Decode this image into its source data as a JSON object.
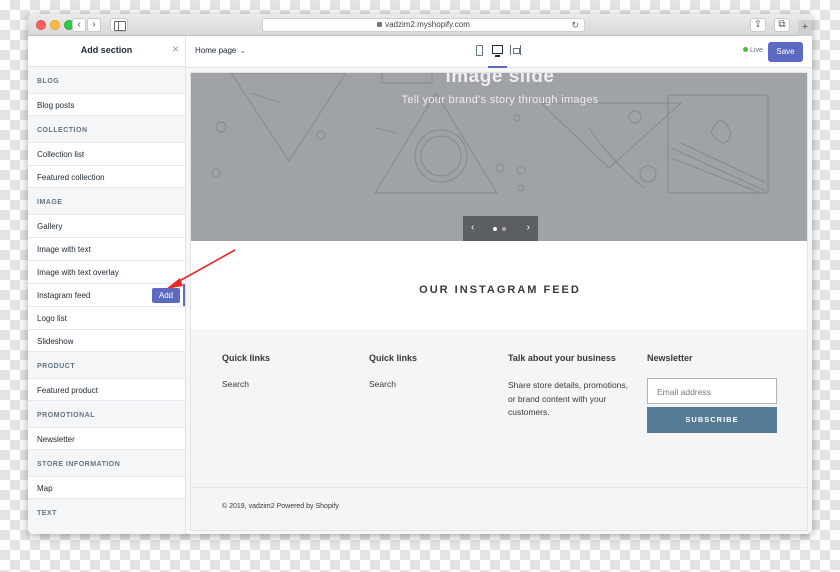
{
  "browser": {
    "url": "vadzim2.myshopify.com",
    "back": "‹",
    "forward": "›",
    "reload": "↻",
    "new_tab": "+",
    "share": "⇪",
    "tabs": "⧉"
  },
  "sidebar": {
    "title": "Add section",
    "close": "×",
    "groups": [
      {
        "label": "BLOG",
        "items": [
          {
            "label": "Blog posts"
          }
        ]
      },
      {
        "label": "COLLECTION",
        "items": [
          {
            "label": "Collection list"
          },
          {
            "label": "Featured collection"
          }
        ]
      },
      {
        "label": "IMAGE",
        "items": [
          {
            "label": "Gallery"
          },
          {
            "label": "Image with text"
          },
          {
            "label": "Image with text overlay"
          },
          {
            "label": "Instagram feed",
            "action": "Add"
          },
          {
            "label": "Logo list"
          },
          {
            "label": "Slideshow"
          }
        ]
      },
      {
        "label": "PRODUCT",
        "items": [
          {
            "label": "Featured product"
          }
        ]
      },
      {
        "label": "PROMOTIONAL",
        "items": [
          {
            "label": "Newsletter"
          }
        ]
      },
      {
        "label": "STORE INFORMATION",
        "items": [
          {
            "label": "Map"
          }
        ]
      },
      {
        "label": "TEXT",
        "items": []
      }
    ]
  },
  "topbar": {
    "page_select": "Home page",
    "chevron": "⌄",
    "live_label": "Live",
    "save_label": "Save"
  },
  "preview": {
    "slideshow": {
      "title": "Image slide",
      "subtitle": "Tell your brand's story through images",
      "prev": "‹",
      "next": "›"
    },
    "instagram_title": "OUR INSTAGRAM FEED",
    "footer": {
      "columns": [
        {
          "title": "Quick links",
          "link": "Search"
        },
        {
          "title": "Quick links",
          "link": "Search"
        },
        {
          "title": "Talk about your business",
          "text": "Share store details, promotions, or brand content with your customers."
        },
        {
          "title": "Newsletter",
          "email_placeholder": "Email address",
          "button": "SUBSCRIBE"
        }
      ],
      "copyright": "© 2019, vadzim2 Powered by Shopify"
    }
  },
  "colors": {
    "accent": "#5c6ac4",
    "subscribe": "#557b97",
    "live": "#50b83c",
    "arrow": "#e8262b"
  }
}
